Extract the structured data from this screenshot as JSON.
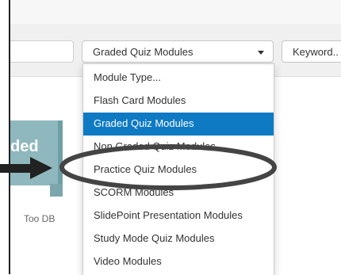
{
  "filters": {
    "search_placeholder": "",
    "module_select": {
      "selected": "Graded Quiz Modules"
    },
    "keyword_label": "Keyword.."
  },
  "dropdown": {
    "items": [
      {
        "label": "Module Type...",
        "selected": false
      },
      {
        "label": "Flash Card Modules",
        "selected": false
      },
      {
        "label": "Graded Quiz Modules",
        "selected": true
      },
      {
        "label": "Non Graded Quiz Modules",
        "selected": false
      },
      {
        "label": "Practice Quiz Modules",
        "selected": false
      },
      {
        "label": "SCORM Modules",
        "selected": false
      },
      {
        "label": "SlidePoint Presentation Modules",
        "selected": false
      },
      {
        "label": "Study Mode Quiz Modules",
        "selected": false
      },
      {
        "label": "Video Modules",
        "selected": false
      }
    ]
  },
  "thumbnail": {
    "partial_text": "ded",
    "caption": "Too DB"
  },
  "colors": {
    "selected_bg": "#0f7ac4",
    "annotation": "#222222",
    "thumbnail": "#8fb8be"
  },
  "annotation": {
    "arrow_icon": "right-arrow-icon",
    "ellipse": "highlight-ellipse"
  }
}
